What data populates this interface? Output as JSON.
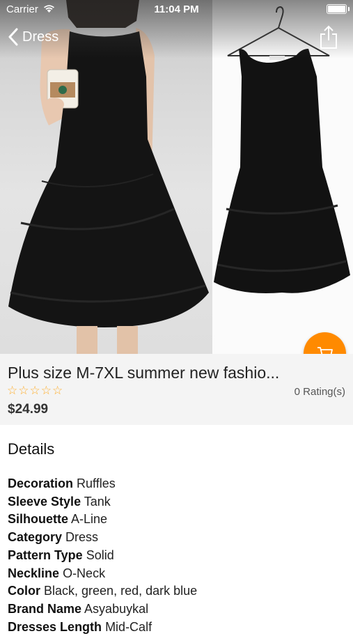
{
  "status_bar": {
    "carrier": "Carrier",
    "time": "11:04 PM"
  },
  "nav": {
    "back_label": "Dress",
    "back_icon": "chevron-left-icon",
    "share_icon": "share-icon"
  },
  "cart_button": {
    "icon": "cart-icon",
    "color": "#ff8a00"
  },
  "product": {
    "title": "Plus size M-7XL summer new fashio...",
    "stars": [
      "☆",
      "☆",
      "☆",
      "☆",
      "☆"
    ],
    "star_color": "#ffae2a",
    "rating_text": "0 Rating(s)",
    "price": "$24.99"
  },
  "details": {
    "heading": "Details",
    "specs": [
      {
        "key": "Decoration",
        "value": "Ruffles"
      },
      {
        "key": "Sleeve Style",
        "value": "Tank"
      },
      {
        "key": "Silhouette",
        "value": "A-Line"
      },
      {
        "key": "Category",
        "value": "Dress"
      },
      {
        "key": "Pattern Type",
        "value": "Solid"
      },
      {
        "key": "Neckline",
        "value": "O-Neck"
      },
      {
        "key": "Color",
        "value": "Black, green, red, dark blue"
      },
      {
        "key": "Brand Name",
        "value": "Asyabuykal"
      },
      {
        "key": "Dresses Length",
        "value": "Mid-Calf"
      }
    ]
  }
}
